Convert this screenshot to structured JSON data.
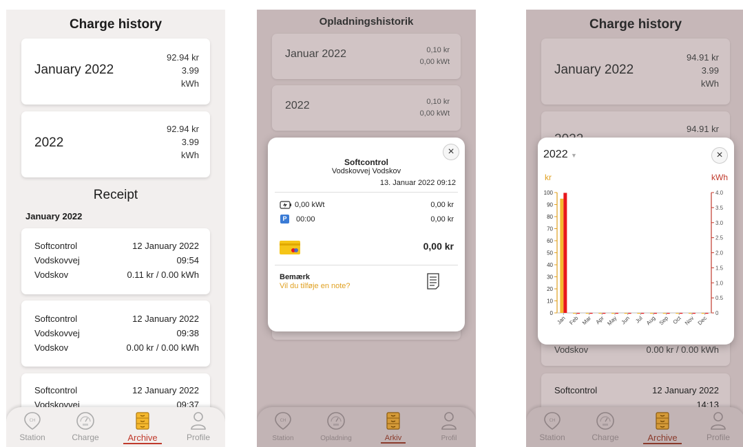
{
  "phone1": {
    "title": "Charge history",
    "cards": [
      {
        "label": "January 2022",
        "amount": "92.94 kr",
        "energy_num": "3.99",
        "energy_unit": "kWh"
      },
      {
        "label": "2022",
        "amount": "92.94 kr",
        "energy_num": "3.99",
        "energy_unit": "kWh"
      }
    ],
    "receipt_title": "Receipt",
    "receipt_month": "January 2022",
    "receipts": [
      {
        "company": "Softcontrol",
        "street": "Vodskovvej",
        "city": "Vodskov",
        "date": "12 January 2022",
        "time": "09:54",
        "summary": "0.11 kr / 0.00 kWh"
      },
      {
        "company": "Softcontrol",
        "street": "Vodskovvej",
        "city": "Vodskov",
        "date": "12 January 2022",
        "time": "09:38",
        "summary": "0.00 kr / 0.00 kWh"
      },
      {
        "company": "Softcontrol",
        "street": "Vodskovvej",
        "date": "12 January 2022",
        "time": "09:37"
      }
    ],
    "nav": [
      "Station",
      "Charge",
      "Archive",
      "Profile"
    ]
  },
  "phone2": {
    "title": "Opladningshistorik",
    "cards": [
      {
        "label": "Januar 2022",
        "amount": "0,10 kr",
        "energy": "0,00 kWt"
      },
      {
        "label": "2022",
        "amount": "0,10 kr",
        "energy": "0,00 kWt"
      }
    ],
    "modal": {
      "company": "Softcontrol",
      "address": "Vodskovvej Vodskov",
      "datetime": "13. Januar 2022 09:12",
      "energy_label": "0,00 kWt",
      "energy_price": "0,00 kr",
      "parking_badge": "P",
      "parking_time": "00:00",
      "parking_price": "0,00 kr",
      "total": "0,00 kr",
      "note_label": "Bemærk",
      "note_prompt": "Vil du tilføje en note?",
      "close": "×"
    },
    "nav": [
      "Station",
      "Opladning",
      "Arkiv",
      "Profil"
    ]
  },
  "phone3": {
    "title": "Charge history",
    "cards": [
      {
        "label": "January 2022",
        "amount": "94.91 kr",
        "energy_num": "3.99",
        "energy_unit": "kWh"
      },
      {
        "label": "2022",
        "amount": "94.91 kr"
      }
    ],
    "behind_text": {
      "city": "Vodskov",
      "summary": "0.00 kr / 0.00 kWh"
    },
    "receipt_peek": {
      "company": "Softcontrol",
      "date": "12 January 2022",
      "time": "14:13"
    },
    "modal": {
      "year": "2022",
      "close": "×"
    },
    "nav": [
      "Station",
      "Charge",
      "Archive",
      "Profile"
    ]
  },
  "colors": {
    "accent": "#c0392b",
    "kr_bar": "#f5b82e",
    "kwh_bar": "#e8171c",
    "left_axis": "#e0a020",
    "right_axis": "#c0392b"
  },
  "chart_data": {
    "type": "bar",
    "title": "",
    "categories": [
      "Jan",
      "Feb",
      "Mar",
      "Apr",
      "May",
      "Jun",
      "Jul",
      "Aug",
      "Sep",
      "Oct",
      "Nov",
      "Dec"
    ],
    "series": [
      {
        "name": "kr",
        "axis": "left",
        "values": [
          94.91,
          0,
          0,
          0,
          0,
          0,
          0,
          0,
          0,
          0,
          0,
          0
        ]
      },
      {
        "name": "kWh",
        "axis": "right",
        "values": [
          3.99,
          0,
          0,
          0,
          0,
          0,
          0,
          0,
          0,
          0,
          0,
          0
        ]
      }
    ],
    "y_left": {
      "label": "kr",
      "range": [
        0,
        100
      ],
      "ticks": [
        "0",
        "10",
        "20",
        "30",
        "40",
        "50",
        "60",
        "70",
        "80",
        "90",
        "100"
      ]
    },
    "y_right": {
      "label": "kWh",
      "range": [
        0,
        4.0
      ],
      "ticks": [
        "0",
        "0.5",
        "1.0",
        "1.5",
        "2.0",
        "2.5",
        "3.0",
        "3.5",
        "4.0"
      ]
    },
    "grid": false,
    "legend": "none"
  }
}
